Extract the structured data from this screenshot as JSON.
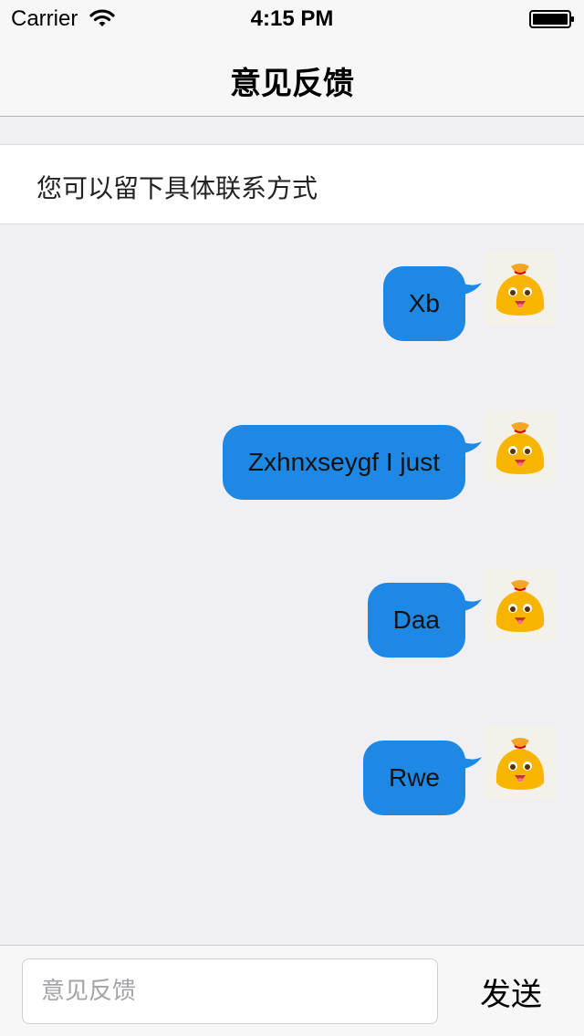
{
  "status_bar": {
    "carrier": "Carrier",
    "time": "4:15 PM"
  },
  "nav": {
    "title": "意见反馈"
  },
  "contact_hint": "您可以留下具体联系方式",
  "messages": [
    {
      "text": "Xb",
      "avatar_icon": "money-bag-mascot-icon"
    },
    {
      "text": "Zxhnxseygf I just",
      "avatar_icon": "money-bag-mascot-icon"
    },
    {
      "text": "Daa",
      "avatar_icon": "money-bag-mascot-icon"
    },
    {
      "text": "Rwe",
      "avatar_icon": "money-bag-mascot-icon"
    }
  ],
  "input_bar": {
    "placeholder": "意见反馈",
    "value": "",
    "send_label": "发送"
  },
  "colors": {
    "bubble": "#1e88e5",
    "background": "#efeff4",
    "bar": "#f7f7f7"
  }
}
